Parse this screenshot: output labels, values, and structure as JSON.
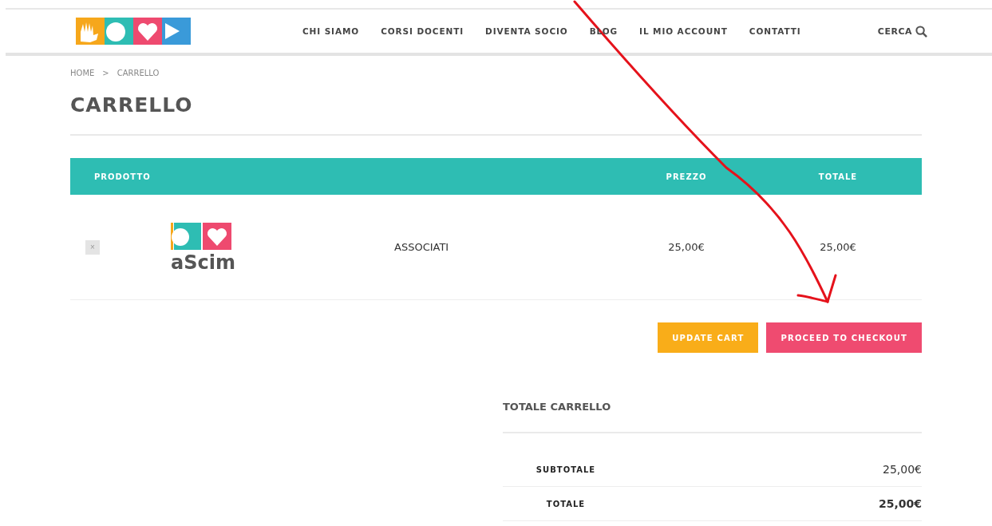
{
  "nav": {
    "items": [
      {
        "label": "CHI SIAMO"
      },
      {
        "label": "CORSI DOCENTI"
      },
      {
        "label": "DIVENTA SOCIO"
      },
      {
        "label": "BLOG"
      },
      {
        "label": "IL MIO ACCOUNT"
      },
      {
        "label": "CONTATTI"
      }
    ],
    "search_label": "CERCA"
  },
  "breadcrumb": [
    "HOME",
    "CARRELLO"
  ],
  "breadcrumb_separator": ">",
  "page_title": "CARRELLO",
  "cart_table": {
    "columns": [
      "PRODOTTO",
      "PREZZO",
      "TOTALE"
    ],
    "rows": [
      {
        "remove": "×",
        "thumbnail_text": "aScim",
        "product": "ASSOCIATI",
        "price": "25,00€",
        "total": "25,00€"
      }
    ]
  },
  "buttons": [
    {
      "label": "UPDATE CART",
      "kind": "secondary"
    },
    {
      "label": "PROCEED TO CHECKOUT",
      "kind": "primary"
    }
  ],
  "totals": {
    "title": "TOTALE CARRELLO",
    "rows": [
      {
        "label": "SUBTOTALE",
        "value": "25,00€",
        "emphasis": false
      },
      {
        "label": "TOTALE",
        "value": "25,00€",
        "emphasis": true
      }
    ]
  }
}
